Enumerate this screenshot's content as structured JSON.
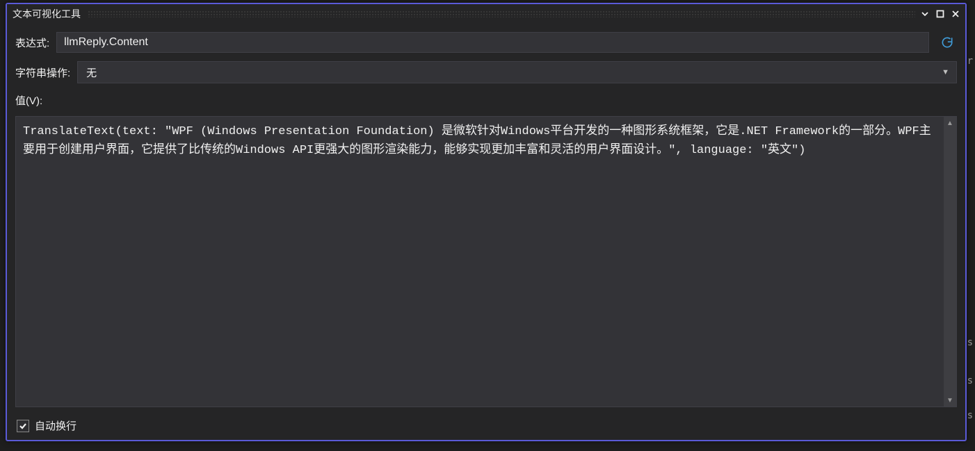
{
  "window": {
    "title": "文本可视化工具"
  },
  "expression": {
    "label": "表达式:",
    "value": "llmReply.Content"
  },
  "stringOp": {
    "label": "字符串操作:",
    "selected": "无"
  },
  "valueSection": {
    "label": "值(V):",
    "content": "TranslateText(text: \"WPF (Windows Presentation Foundation) 是微软针对Windows平台开发的一种图形系统框架，它是.NET Framework的一部分。WPF主要用于创建用户界面，它提供了比传统的Windows API更强大的图形渲染能力，能够实现更加丰富和灵活的用户界面设计。\", language: \"英文\")"
  },
  "footer": {
    "wordWrapLabel": "自动换行",
    "wordWrapChecked": true
  },
  "edgeChars": {
    "c1": "r",
    "c2": "s",
    "c3": "s",
    "c4": "s"
  }
}
